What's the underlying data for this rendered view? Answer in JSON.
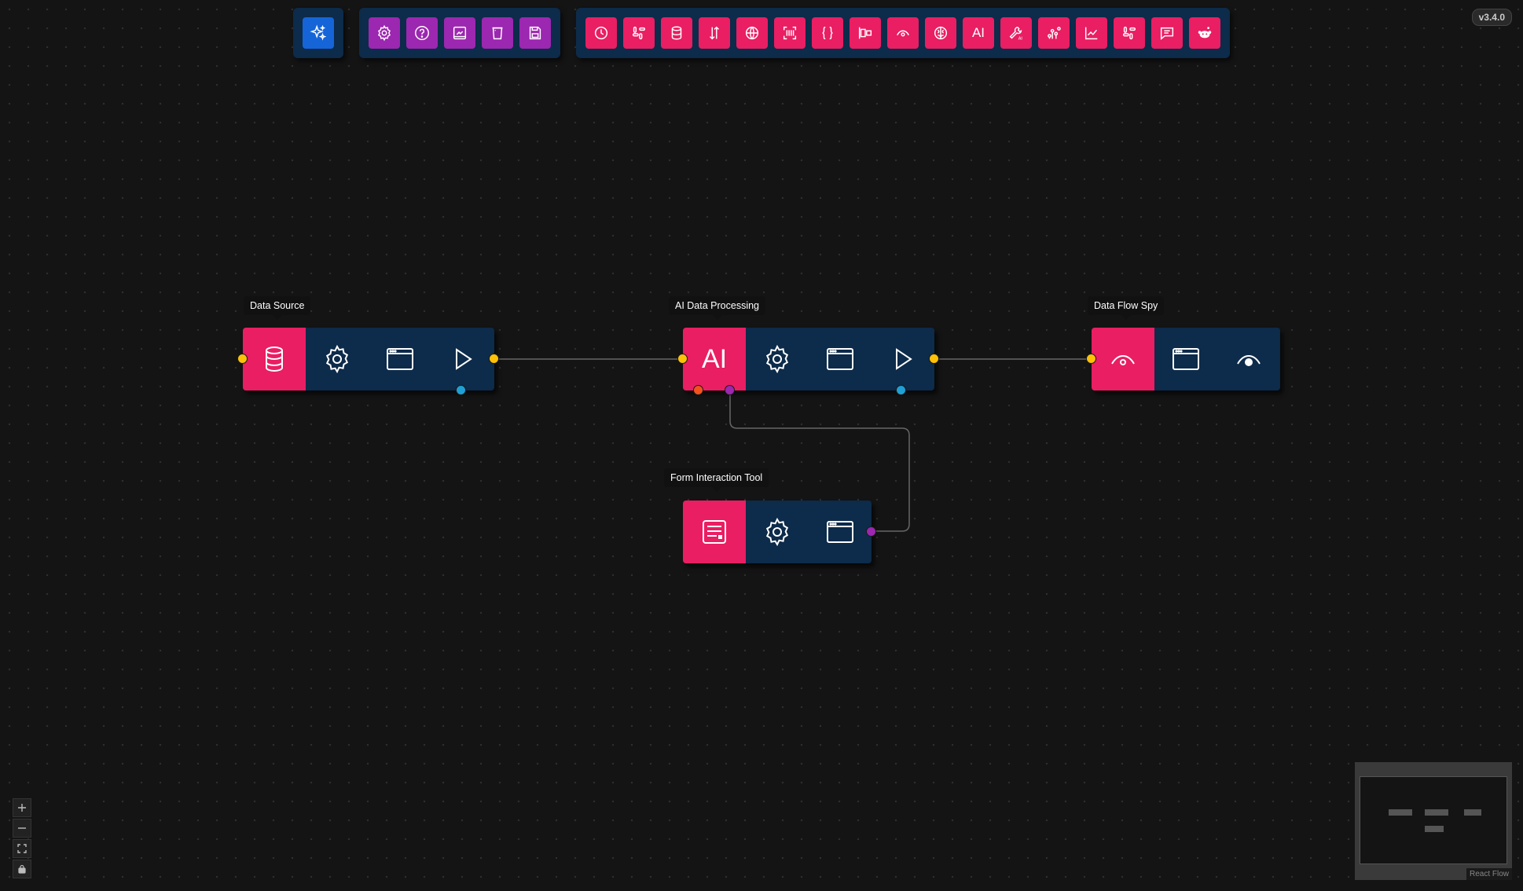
{
  "version": "v3.4.0",
  "toolbars": {
    "main": [
      {
        "name": "ai-sparkle",
        "icon": "sparkle-icon"
      }
    ],
    "settings": [
      {
        "name": "settings",
        "icon": "gear-icon"
      },
      {
        "name": "help",
        "icon": "help-icon"
      },
      {
        "name": "import",
        "icon": "import-icon"
      },
      {
        "name": "clear",
        "icon": "trash-icon"
      },
      {
        "name": "save",
        "icon": "save-icon"
      }
    ],
    "nodes": [
      {
        "name": "scheduler",
        "icon": "clock-icon"
      },
      {
        "name": "slack",
        "icon": "slack-icon"
      },
      {
        "name": "database",
        "icon": "database-icon"
      },
      {
        "name": "sort",
        "icon": "sort-icon"
      },
      {
        "name": "web",
        "icon": "globe-icon"
      },
      {
        "name": "scanner",
        "icon": "scanner-icon"
      },
      {
        "name": "json",
        "icon": "braces-icon"
      },
      {
        "name": "align",
        "icon": "align-icon"
      },
      {
        "name": "spy",
        "icon": "eye-icon"
      },
      {
        "name": "brain",
        "icon": "brain-icon"
      },
      {
        "name": "ai",
        "icon": "ai-text",
        "text": "AI"
      },
      {
        "name": "ai-tools",
        "icon": "wrench-ai-icon"
      },
      {
        "name": "graph-points",
        "icon": "scatter-icon"
      },
      {
        "name": "line-chart",
        "icon": "line-chart-icon"
      },
      {
        "name": "slack-2",
        "icon": "slack-icon"
      },
      {
        "name": "chat",
        "icon": "chat-icon"
      },
      {
        "name": "reddit",
        "icon": "reddit-icon"
      }
    ]
  },
  "nodes": {
    "data_source": {
      "label": "Data Source"
    },
    "ai_processing": {
      "label": "AI Data Processing",
      "badge": "AI"
    },
    "data_flow_spy": {
      "label": "Data Flow Spy"
    },
    "form_tool": {
      "label": "Form Interaction Tool"
    }
  },
  "colors": {
    "canvas": "#141414",
    "node_body": "#0d2b4a",
    "node_accent": "#e91e63",
    "toolbar_blue": "#1565d8",
    "toolbar_purple": "#9c27b0",
    "handle_yellow": "#ffc107",
    "handle_blue": "#1ea0d5",
    "handle_red": "#f4511e",
    "handle_purple": "#9c27b0"
  },
  "attribution": "React Flow"
}
